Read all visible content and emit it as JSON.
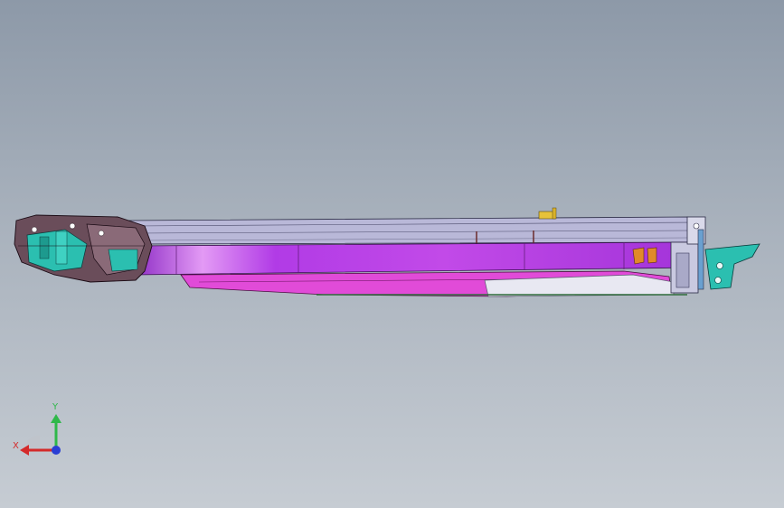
{
  "viewport": {
    "background_top": "#8d99a8",
    "background_bottom": "#c6ccd3"
  },
  "model": {
    "description_colors": {
      "rail_top": "#b9b8d8",
      "beam": "#b13be6",
      "beam_highlight": "#d77af2",
      "lower_channel": "#e14bd8",
      "bracket_teal": "#2bbfb0",
      "housing_dark": "#6a4d5a",
      "plate_white": "#e8e8f2",
      "tab_yellow": "#e6c23a",
      "clip_orange": "#e08a2a"
    }
  },
  "triad": {
    "x_label": "X",
    "y_label": "Y",
    "x_color": "#d42a2a",
    "y_color": "#2fb84a",
    "z_color": "#2a3fd4"
  }
}
